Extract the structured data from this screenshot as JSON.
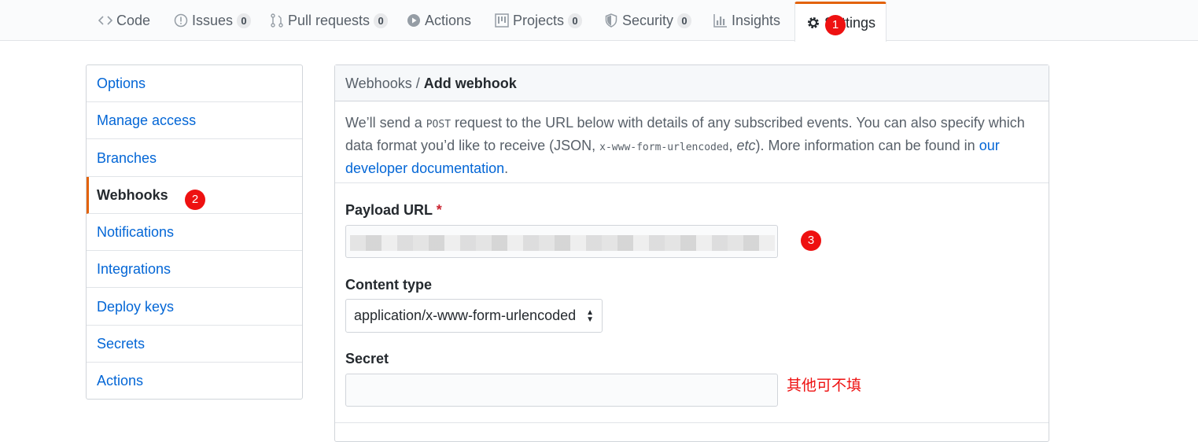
{
  "tabs": [
    {
      "label": "Code",
      "icon": "code-icon",
      "counter": null
    },
    {
      "label": "Issues",
      "icon": "issue-icon",
      "counter": "0"
    },
    {
      "label": "Pull requests",
      "icon": "pull-request-icon",
      "counter": "0"
    },
    {
      "label": "Actions",
      "icon": "play-icon",
      "counter": null
    },
    {
      "label": "Projects",
      "icon": "project-icon",
      "counter": "0"
    },
    {
      "label": "Security",
      "icon": "shield-icon",
      "counter": "0"
    },
    {
      "label": "Insights",
      "icon": "graph-icon",
      "counter": null
    },
    {
      "label": "Settings",
      "icon": "gear-icon",
      "counter": null
    }
  ],
  "markers": [
    "1",
    "2",
    "3"
  ],
  "menu": {
    "items": [
      "Options",
      "Manage access",
      "Branches",
      "Webhooks",
      "Notifications",
      "Integrations",
      "Deploy keys",
      "Secrets",
      "Actions"
    ],
    "selected": "Webhooks"
  },
  "breadcrumb": {
    "parent": "Webhooks",
    "separator": "/",
    "current": "Add webhook"
  },
  "intro": {
    "part1": "We’ll send a ",
    "code1": "POST",
    "part2": " request to the URL below with details of any subscribed events. You can also specify which data format you’d like to receive (JSON, ",
    "code2": "x-www-form-urlencoded",
    "part3": ", ",
    "etc": "etc",
    "part4": "). More information can be found in ",
    "link": "our developer documentation",
    "part5": "."
  },
  "form": {
    "payload_label": "Payload URL",
    "required_mark": "*",
    "content_type_label": "Content type",
    "content_type_value": "application/x-www-form-urlencoded",
    "secret_label": "Secret",
    "secret_value": ""
  },
  "annotation_note": "其他可不填",
  "colors": {
    "accent": "#e36209",
    "link": "#0366d6",
    "marker": "#ee1111"
  }
}
